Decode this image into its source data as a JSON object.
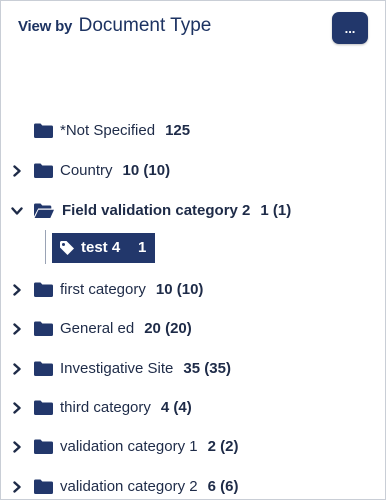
{
  "header": {
    "prefix": "View by",
    "title": "Document Type",
    "more_label": "..."
  },
  "tree": [
    {
      "label": "*Not Specified",
      "count": "125",
      "expand": "none",
      "icon": "folder-icon",
      "bold": false
    },
    {
      "label": "Country",
      "count": "10 (10)",
      "expand": "collapsed",
      "icon": "folder-icon",
      "bold": false
    },
    {
      "label": "Field validation category 2",
      "count": "1 (1)",
      "expand": "expanded",
      "icon": "folder-open-icon",
      "bold": true
    },
    {
      "label": "first category",
      "count": "10 (10)",
      "expand": "collapsed",
      "icon": "folder-icon",
      "bold": false
    },
    {
      "label": "General ed",
      "count": "20 (20)",
      "expand": "collapsed",
      "icon": "folder-icon",
      "bold": false
    },
    {
      "label": "Investigative Site",
      "count": "35 (35)",
      "expand": "collapsed",
      "icon": "folder-icon",
      "bold": false
    },
    {
      "label": "third category",
      "count": "4 (4)",
      "expand": "collapsed",
      "icon": "folder-icon",
      "bold": false
    },
    {
      "label": "validation category 1",
      "count": "2 (2)",
      "expand": "collapsed",
      "icon": "folder-icon",
      "bold": false
    },
    {
      "label": "validation category 2",
      "count": "6 (6)",
      "expand": "collapsed",
      "icon": "folder-icon",
      "bold": false
    }
  ],
  "selected_tag": {
    "label": "test 4",
    "count": "1",
    "icon": "tag-icon"
  },
  "colors": {
    "navy": "#22376b",
    "text": "#1e2b48",
    "border": "#c9ced6"
  }
}
